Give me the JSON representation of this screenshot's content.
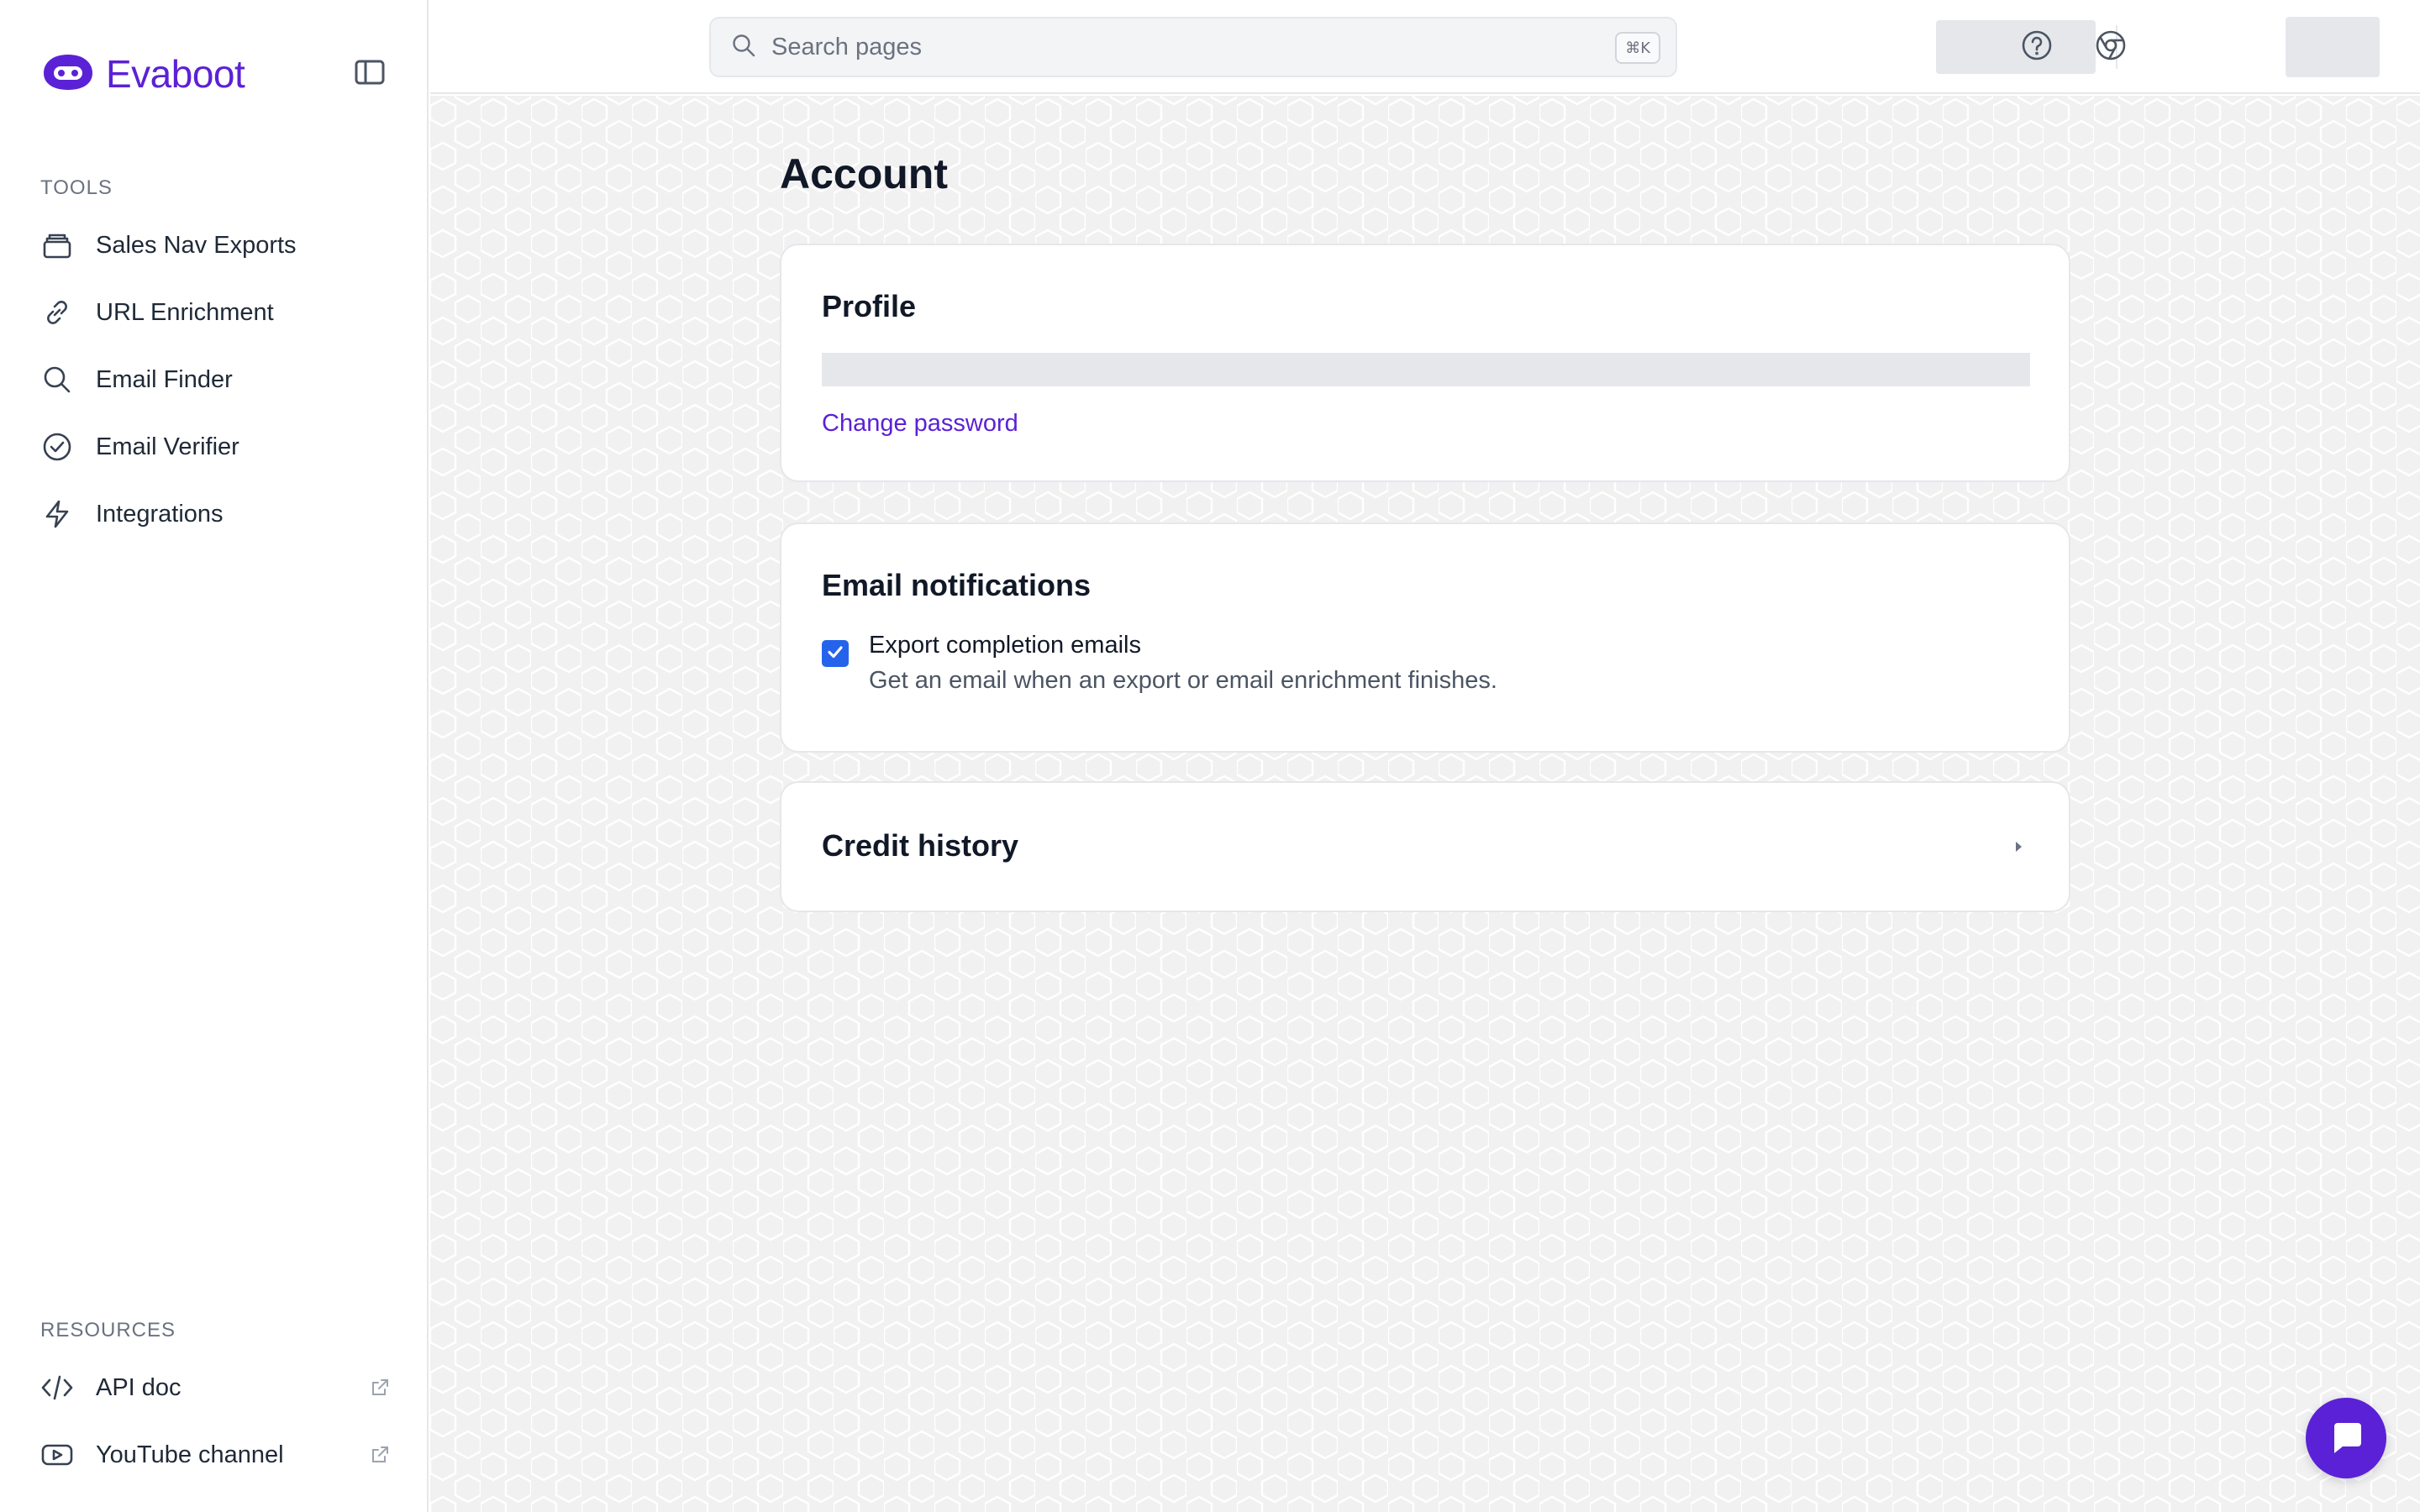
{
  "brand": {
    "name": "Evaboot",
    "color": "#5b21d6"
  },
  "sidebar": {
    "tools_label": "TOOLS",
    "tools": [
      {
        "label": "Sales Nav Exports",
        "icon": "layers-icon"
      },
      {
        "label": "URL Enrichment",
        "icon": "link-icon"
      },
      {
        "label": "Email Finder",
        "icon": "search-icon"
      },
      {
        "label": "Email Verifier",
        "icon": "check-circle-icon"
      },
      {
        "label": "Integrations",
        "icon": "bolt-icon"
      }
    ],
    "resources_label": "RESOURCES",
    "resources": [
      {
        "label": "API doc",
        "icon": "code-icon",
        "external": true
      },
      {
        "label": "YouTube channel",
        "icon": "youtube-icon",
        "external": true
      }
    ]
  },
  "topbar": {
    "search_placeholder": "Search pages",
    "shortcut": "⌘K"
  },
  "main": {
    "title": "Account",
    "profile": {
      "title": "Profile",
      "change_password": "Change password"
    },
    "notifications": {
      "title": "Email notifications",
      "export_label": "Export completion emails",
      "export_desc": "Get an email when an export or email enrichment finishes.",
      "export_checked": true
    },
    "credit_history": {
      "title": "Credit history"
    }
  },
  "colors": {
    "accent": "#5b21d6",
    "checkbox": "#2563eb"
  }
}
